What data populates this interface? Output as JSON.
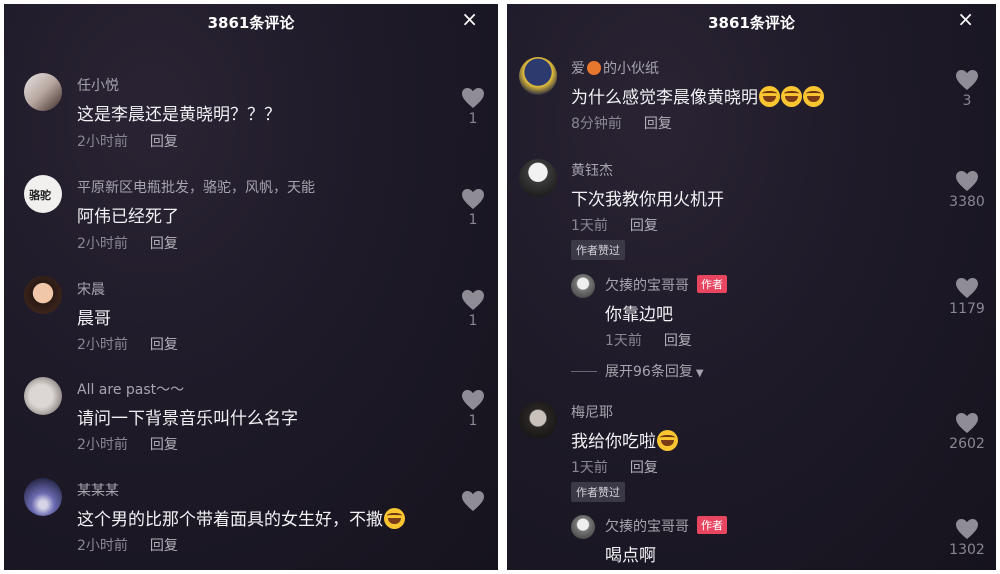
{
  "left": {
    "title": "3861条评论",
    "close": "×",
    "comments": [
      {
        "name": "任小悦",
        "text": "这是李晨还是黄晓明？？？",
        "time": "2小时前",
        "reply": "回复",
        "likes": "1"
      },
      {
        "name": "平原新区电瓶批发，骆驼，风帆，天能",
        "text": "阿伟已经死了",
        "time": "2小时前",
        "reply": "回复",
        "likes": "1",
        "avatar_text": "骆驼"
      },
      {
        "name": "宋晨",
        "text": "晨哥",
        "time": "2小时前",
        "reply": "回复",
        "likes": "1"
      },
      {
        "name": "All are past～～",
        "text": "请问一下背景音乐叫什么名字",
        "time": "2小时前",
        "reply": "回复",
        "likes": "1"
      },
      {
        "name": "某某某",
        "text": "这个男的比那个带着面具的女生好，不撒",
        "time": "2小时前",
        "reply": "回复",
        "likes": ""
      }
    ]
  },
  "right": {
    "title": "3861条评论",
    "close": "×",
    "comments": [
      {
        "name_pre": "爱",
        "name_post": "的小伙纸",
        "text": "为什么感觉李晨像黄晓明",
        "time": "8分钟前",
        "reply": "回复",
        "likes": "3"
      },
      {
        "name": "黄钰杰",
        "text": "下次我教你用火机开",
        "time": "1天前",
        "reply": "回复",
        "likes": "3380",
        "badge": "作者赞过"
      },
      {
        "name": "欠揍的宝哥哥",
        "author": "作者",
        "text": "你靠边吧",
        "time": "1天前",
        "reply": "回复",
        "likes": "1179"
      },
      {
        "name": "梅尼耶",
        "text": "我给你吃啦",
        "time": "1天前",
        "reply": "回复",
        "likes": "2602",
        "badge": "作者赞过"
      },
      {
        "name": "欠揍的宝哥哥",
        "author": "作者",
        "text": "喝点啊",
        "likes": "1302"
      }
    ],
    "expand": "展开96条回复"
  },
  "colors": {
    "panel_bg": "#1e1a28",
    "author_badge": "#e84660",
    "text": "#f2f1f4",
    "muted": "#8a8791"
  },
  "icons": [
    "heart-icon",
    "close-icon",
    "laughing-emoji-icon",
    "basketball-emoji-icon",
    "chevron-down-icon"
  ]
}
